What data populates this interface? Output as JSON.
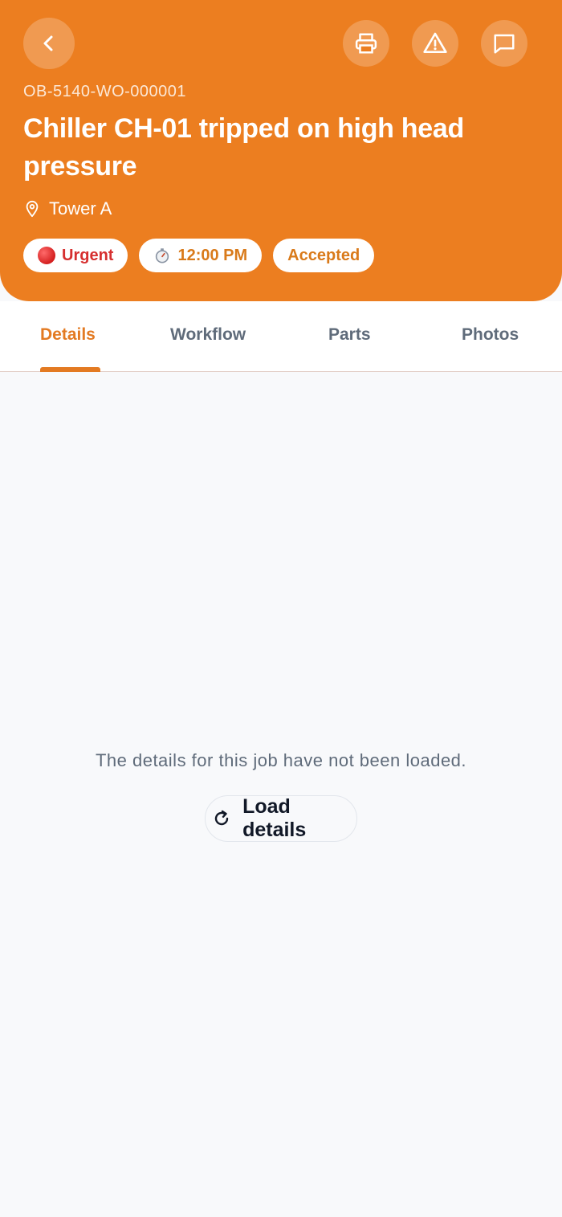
{
  "header": {
    "work_order_id": "OB-5140-WO-000001",
    "title": "Chiller CH-01 tripped on high head pressure",
    "location": "Tower A",
    "chips": {
      "priority": "Urgent",
      "time": "12:00 PM",
      "status": "Accepted"
    },
    "actions": [
      "back-icon",
      "printer-icon",
      "warning-icon",
      "chat-icon"
    ]
  },
  "tabs": [
    {
      "label": "Details",
      "active": true
    },
    {
      "label": "Workflow",
      "active": false
    },
    {
      "label": "Parts",
      "active": false
    },
    {
      "label": "Photos",
      "active": false
    }
  ],
  "empty_state": {
    "message": "The details for this job have not been loaded.",
    "button_label": "Load details",
    "button_icon": "refresh-icon"
  },
  "colors": {
    "accent": "#ec7e20",
    "urgent": "#d62f2f",
    "muted_text": "#5f6b7a",
    "background": "#f8f9fb"
  }
}
